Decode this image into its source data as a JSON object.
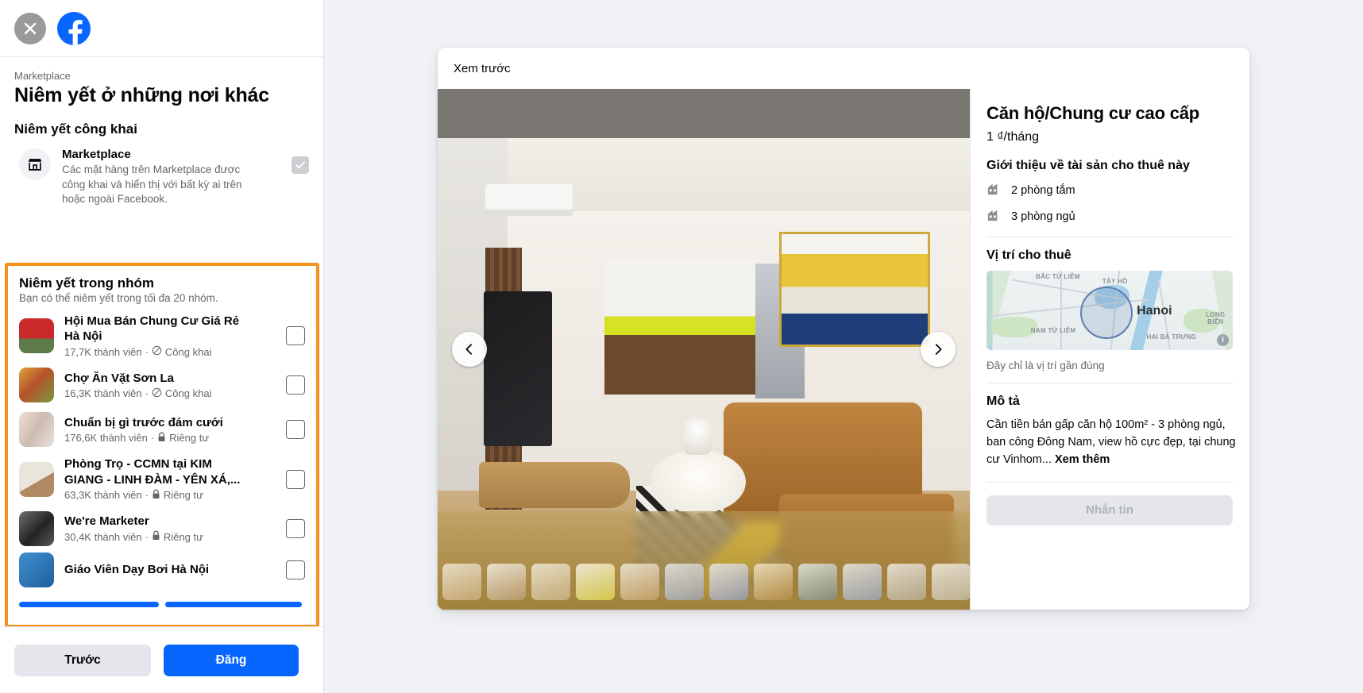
{
  "left": {
    "header": {
      "close_icon": "close-icon",
      "logo_icon": "facebook-logo-icon"
    },
    "breadcrumb": "Marketplace",
    "page_title": "Niêm yết ở những nơi khác",
    "public_section": {
      "title": "Niêm yết công khai",
      "item": {
        "icon": "marketplace-storefront-icon",
        "name": "Marketplace",
        "description": "Các mặt hàng trên Marketplace được công khai và hiển thị với bất kỳ ai trên hoặc ngoài Facebook.",
        "checked": true
      }
    },
    "groups_section": {
      "title": "Niêm yết trong nhóm",
      "subtitle": "Bạn có thể niêm yết trong tối đa 20 nhóm.",
      "highlight_color": "#f5921e",
      "items": [
        {
          "name": "Hội Mua Bán Chung Cư Giá Rẻ Hà Nội",
          "members": "17,7K thành viên",
          "privacy": "Công khai",
          "privacy_icon": "globe-icon",
          "checked": false
        },
        {
          "name": "Chợ Ăn Vặt Sơn La",
          "members": "16,3K thành viên",
          "privacy": "Công khai",
          "privacy_icon": "globe-icon",
          "checked": false
        },
        {
          "name": "Chuẩn bị gì trước đám cưới",
          "members": "176,6K thành viên",
          "privacy": "Riêng tư",
          "privacy_icon": "lock-icon",
          "checked": false
        },
        {
          "name": "Phòng Trọ - CCMN tại KIM GIANG - LINH ĐÀM - YÊN XÁ,...",
          "members": "63,3K thành viên",
          "privacy": "Riêng tư",
          "privacy_icon": "lock-icon",
          "checked": false
        },
        {
          "name": "We're Marketer",
          "members": "30,4K thành viên",
          "privacy": "Riêng tư",
          "privacy_icon": "lock-icon",
          "checked": false
        },
        {
          "name": "Giáo Viên Dạy Bơi Hà Nội",
          "members": "",
          "privacy": "",
          "privacy_icon": "",
          "checked": false
        }
      ]
    },
    "footer": {
      "back_label": "Trước",
      "post_label": "Đăng"
    }
  },
  "preview": {
    "header_label": "Xem trước",
    "gallery": {
      "prev_icon": "chevron-left-icon",
      "next_icon": "chevron-right-icon",
      "thumb_count": 13
    },
    "listing": {
      "title": "Căn hộ/Chung cư cao cấp",
      "price": "1 ₫/tháng",
      "about_heading": "Giới thiệu về tài sản cho thuê này",
      "features": [
        {
          "icon": "home-icon",
          "label": "2 phòng tắm"
        },
        {
          "icon": "home-icon",
          "label": "3 phòng ngủ"
        }
      ],
      "location_heading": "Vị trí cho thuê",
      "map": {
        "city_label": "Hanoi",
        "labels": [
          "BẮC TỪ LIÊM",
          "TÂY HỒ",
          "LONG BIÊN",
          "NAM TỪ LIÊM",
          "HAI BÀ TRƯNG"
        ],
        "info_icon": "info-icon"
      },
      "approx_note": "Đây chỉ là vị trí gần đúng",
      "description_heading": "Mô tả",
      "description": "Cần tiền bán gấp căn hộ 100m² - 3 phòng ngủ, ban công Đông Nam, view hồ cực đẹp, tại chung cư Vinhom...",
      "see_more_label": "Xem thêm",
      "message_button_label": "Nhắn tin"
    }
  }
}
